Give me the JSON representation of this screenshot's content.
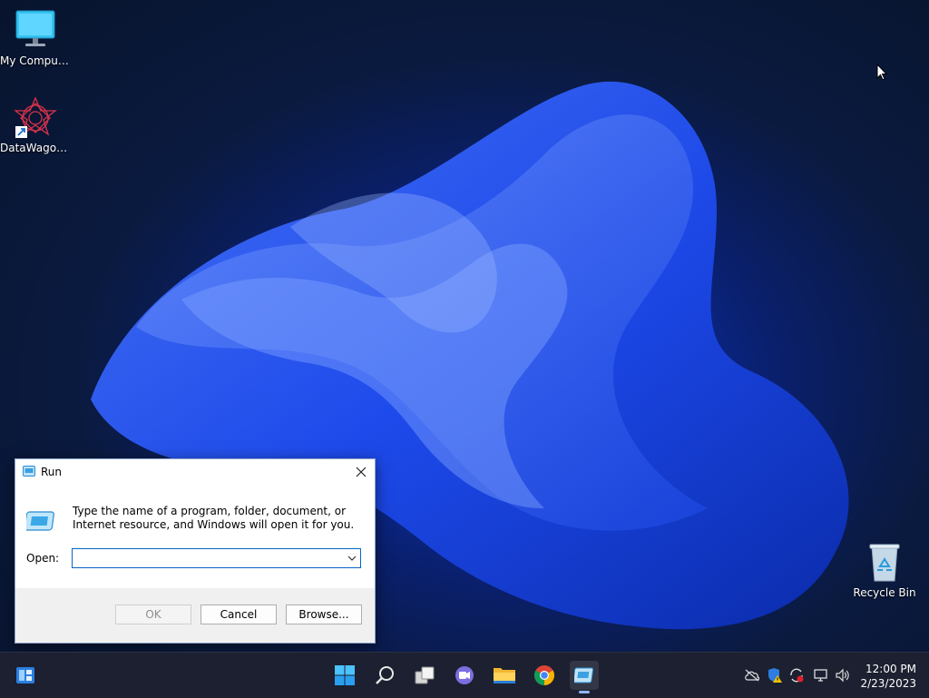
{
  "desktop": {
    "icons": [
      {
        "label": "My Computer",
        "icon": "monitor-icon"
      },
      {
        "label": "DataWagon...",
        "icon": "datawagon-icon"
      },
      {
        "label": "Recycle Bin",
        "icon": "recycle-bin-icon"
      }
    ]
  },
  "run_dialog": {
    "title": "Run",
    "description": "Type the name of a program, folder, document, or Internet resource, and Windows will open it for you.",
    "open_label": "Open:",
    "open_value": "",
    "ok_label": "OK",
    "cancel_label": "Cancel",
    "browse_label": "Browse..."
  },
  "taskbar": {
    "items": [
      "widgets-icon",
      "start-icon",
      "search-icon",
      "task-view-icon",
      "chat-icon",
      "file-explorer-icon",
      "chrome-icon",
      "run-icon"
    ],
    "clock_time": "12:00 PM",
    "clock_date": "2/23/2023"
  },
  "colors": {
    "accent": "#0a64c8",
    "taskbar_bg": "#1c2030"
  }
}
